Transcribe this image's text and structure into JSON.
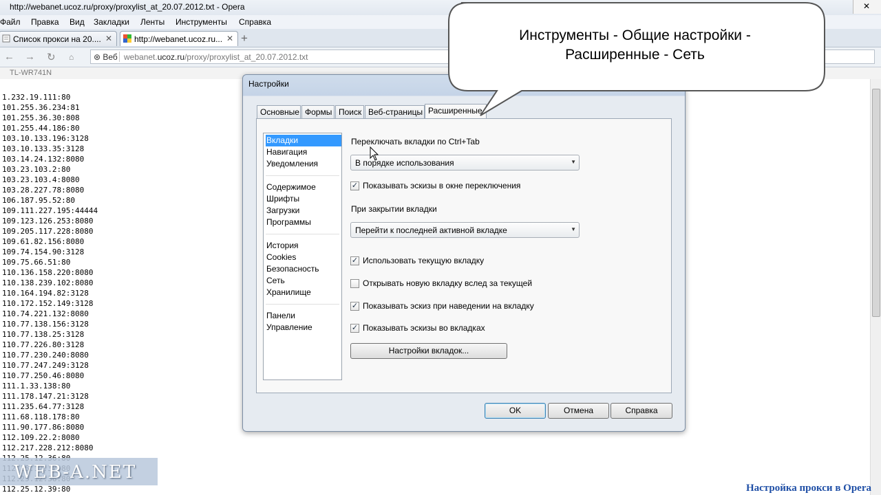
{
  "window": {
    "title": "http://webanet.ucoz.ru/proxy/proxylist_at_20.07.2012.txt - Opera"
  },
  "menu": [
    "Файл",
    "Правка",
    "Вид",
    "Закладки",
    "Ленты",
    "Инструменты",
    "Справка"
  ],
  "tabs": [
    {
      "label": "Список прокси на 20....",
      "close": "✕"
    },
    {
      "label": "http://webanet.ucoz.ru...",
      "close": "✕"
    }
  ],
  "address": {
    "web_label": "Веб",
    "url_prefix": "webanet.",
    "url_host": "ucoz.ru",
    "url_path": "/proxy/proxylist_at_20.07.2012.txt"
  },
  "bookmarks": {
    "item": "TL-WR741N"
  },
  "proxies": [
    "1.232.19.111:80",
    "101.255.36.234:81",
    "101.255.36.30:808",
    "101.255.44.186:80",
    "103.10.133.196:3128",
    "103.10.133.35:3128",
    "103.14.24.132:8080",
    "103.23.103.2:80",
    "103.23.103.4:8080",
    "103.28.227.78:8080",
    "106.187.95.52:80",
    "109.111.227.195:44444",
    "109.123.126.253:8080",
    "109.205.117.228:8080",
    "109.61.82.156:8080",
    "109.74.154.90:3128",
    "109.75.66.51:80",
    "110.136.158.220:8080",
    "110.138.239.102:8080",
    "110.164.194.82:3128",
    "110.172.152.149:3128",
    "110.74.221.132:8080",
    "110.77.138.156:3128",
    "110.77.138.25:3128",
    "110.77.226.80:3128",
    "110.77.230.240:8080",
    "110.77.247.249:3128",
    "110.77.250.46:8080",
    "111.1.33.138:80",
    "111.178.147.21:3128",
    "111.235.64.77:3128",
    "111.68.118.178:80",
    "111.90.177.86:8080",
    "112.109.22.2:8080",
    "112.217.228.212:8080",
    "112.25.12.36:80",
    "112.25.12.37:80",
    "112.25.12.38:80",
    "112.25.12.39:80"
  ],
  "watermark": "WEB-A.NET",
  "caption": "Настройка прокси в Opera",
  "callout": {
    "line1": "Инструменты - Общие настройки -",
    "line2": "Расширенные - Сеть"
  },
  "dialog": {
    "title": "Настройки",
    "tabs": [
      "Основные",
      "Формы",
      "Поиск",
      "Веб-страницы",
      "Расширенные"
    ],
    "active_tab": "Расширенные",
    "categories": {
      "group1": [
        "Вкладки",
        "Навигация",
        "Уведомления"
      ],
      "group2": [
        "Содержимое",
        "Шрифты",
        "Загрузки",
        "Программы"
      ],
      "group3": [
        "История",
        "Cookies",
        "Безопасность",
        "Сеть",
        "Хранилище"
      ],
      "group4": [
        "Панели",
        "Управление"
      ],
      "selected": "Вкладки"
    },
    "ctrl_tab_label": "Переключать вкладки по Ctrl+Tab",
    "ctrl_tab_value": "В порядке использования",
    "show_thumbnails_switch": {
      "label": "Показывать эскизы в окне переключения",
      "checked": true
    },
    "on_close_label": "При закрытии вкладки",
    "on_close_value": "Перейти к последней активной вкладке",
    "use_current_tab": {
      "label": "Использовать текущую вкладку",
      "checked": true
    },
    "open_next": {
      "label": "Открывать новую вкладку вслед за текущей",
      "checked": false
    },
    "hover_thumbnail": {
      "label": "Показывать эскиз при наведении на вкладку",
      "checked": true
    },
    "tab_thumbnails": {
      "label": "Показывать эскизы во вкладках",
      "checked": true
    },
    "tab_settings_button": "Настройки вкладок...",
    "ok": "OK",
    "cancel": "Отмена",
    "help": "Справка"
  },
  "icons": {
    "check": "✓",
    "dropdown": "▼",
    "add_tab": "+"
  },
  "colors": {
    "selection": "#3399ff",
    "caption": "#1f4fa6"
  }
}
